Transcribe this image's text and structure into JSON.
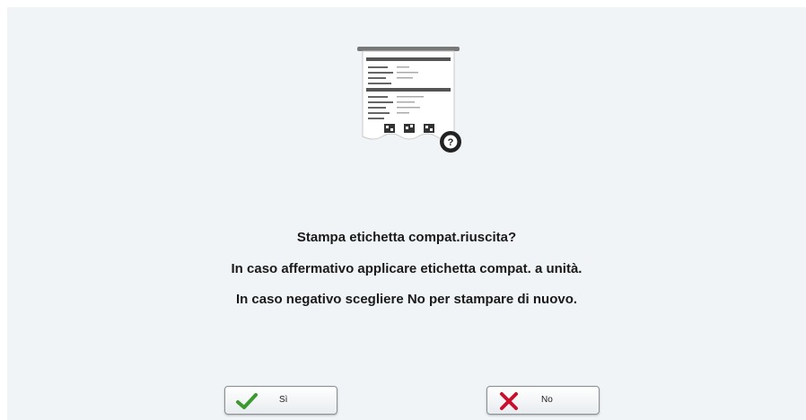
{
  "dialog": {
    "icon": "receipt-question-icon",
    "lines": [
      "Stampa etichetta compat.riuscita?",
      "In caso affermativo applicare etichetta compat. a unità.",
      "In caso negativo scegliere No per stampare di nuovo."
    ],
    "help_mark": "?"
  },
  "buttons": {
    "yes": {
      "label": "Sì",
      "icon": "checkmark-icon",
      "color": "#3a9a2e"
    },
    "no": {
      "label": "No",
      "icon": "x-icon",
      "color": "#c8102e"
    }
  }
}
